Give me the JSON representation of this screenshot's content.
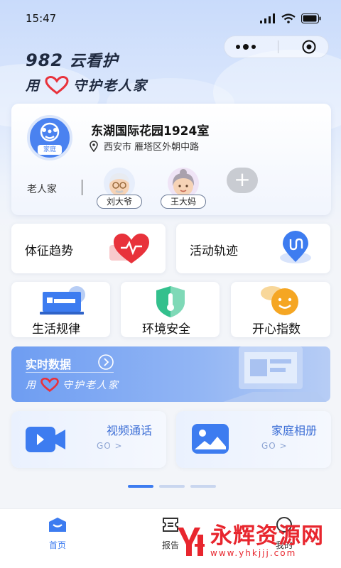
{
  "status_bar": {
    "time": "15:47"
  },
  "brand": {
    "name_num": "982",
    "name_text": "云看护",
    "slogan_pre": "用",
    "slogan_post": "守护老人家"
  },
  "home": {
    "title": "东湖国际花园1924室",
    "address": "西安市 雁塔区外朝中路",
    "badge_tag": "家庭",
    "elders_label": "老人家",
    "elders": [
      {
        "name": "刘大爷"
      },
      {
        "name": "王大妈"
      }
    ],
    "add_symbol": "+"
  },
  "features_row1": [
    {
      "label": "体征趋势",
      "icon": "heart-pulse-icon"
    },
    {
      "label": "活动轨迹",
      "icon": "route-pin-icon"
    }
  ],
  "features_row2": [
    {
      "label": "生活规律",
      "icon": "bed-icon"
    },
    {
      "label": "环境安全",
      "icon": "thermometer-shield-icon"
    },
    {
      "label": "开心指数",
      "icon": "smile-icon"
    }
  ],
  "realtime": {
    "title": "实时数据",
    "slogan_pre": "用",
    "slogan_post": "守护老人家"
  },
  "media": [
    {
      "title": "视频通话",
      "go": "GO  >",
      "icon": "video-camera-icon"
    },
    {
      "title": "家庭相册",
      "go": "GO  >",
      "icon": "photo-album-icon"
    }
  ],
  "pager": {
    "active": 0,
    "count": 3
  },
  "tabbar": [
    {
      "label": "首页",
      "active": true
    },
    {
      "label": "报告"
    },
    {
      "label": "我的"
    }
  ],
  "watermark": {
    "text": "永辉资源网",
    "url": "www.yhkjjj.com"
  },
  "colors": {
    "accent": "#3d7cf0",
    "heart": "#e8323b",
    "brand_text": "#1f2a40"
  }
}
